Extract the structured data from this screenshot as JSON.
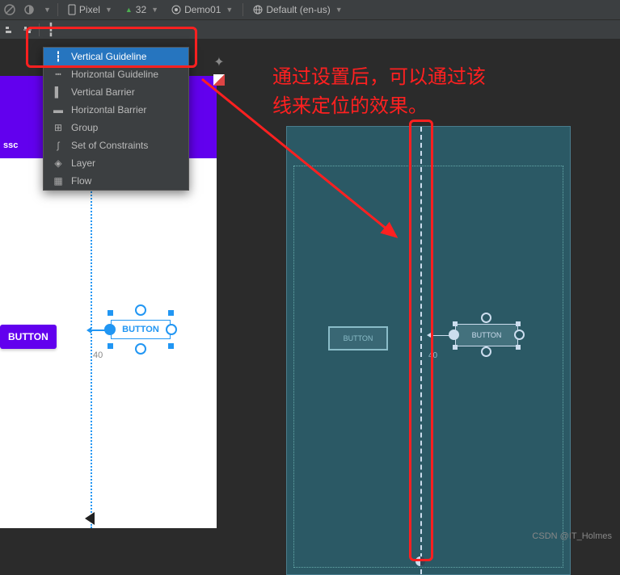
{
  "toolbar": {
    "device": "Pixel",
    "api": "32",
    "theme": "Demo01",
    "locale": "Default (en-us)"
  },
  "dropdown": {
    "items": [
      "Vertical Guideline",
      "Horizontal Guideline",
      "Vertical Barrier",
      "Horizontal Barrier",
      "Group",
      "Set of Constraints",
      "Layer",
      "Flow"
    ],
    "highlighted_index": 0
  },
  "design": {
    "appbar_title": "ssc",
    "button1_label": "BUTTON",
    "button2_label": "BUTTON",
    "margin_value": "40"
  },
  "blueprint": {
    "button1_label": "BUTTON",
    "button2_label": "BUTTON",
    "margin_value": "40"
  },
  "annotation": {
    "line1": "通过设置后，可以通过该",
    "line2": "线来定位的效果。"
  },
  "watermark": "CSDN @IT_Holmes"
}
